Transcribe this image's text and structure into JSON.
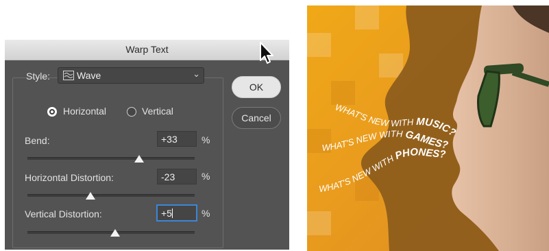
{
  "dialog": {
    "title": "Warp Text",
    "style_label": "Style:",
    "style_value": "Wave",
    "orientation": {
      "horizontal": "Horizontal",
      "vertical": "Vertical",
      "selected": "horizontal"
    },
    "bend": {
      "label": "Bend:",
      "value": "+33",
      "unit": "%"
    },
    "horizontal_distortion": {
      "label": "Horizontal Distortion:",
      "value": "-23",
      "unit": "%"
    },
    "vertical_distortion": {
      "label": "Vertical Distortion:",
      "value": "+5",
      "unit": "%"
    },
    "buttons": {
      "ok": "OK",
      "cancel": "Cancel"
    }
  },
  "photo": {
    "text_lines": [
      {
        "prefix": "WHAT'S NEW WITH",
        "highlight": "MUSIC?"
      },
      {
        "prefix": "WHAT'S NEW WITH",
        "highlight": "GAMES?"
      },
      {
        "prefix": "WHAT'S NEW WITH",
        "highlight": "PHONES?"
      }
    ]
  },
  "colors": {
    "dialog_bg": "#535353",
    "field_focus": "#3d86d6",
    "photo_orange": "#e69a1c",
    "silhouette": "#8a5a1c",
    "glasses": "#2f4a25"
  }
}
